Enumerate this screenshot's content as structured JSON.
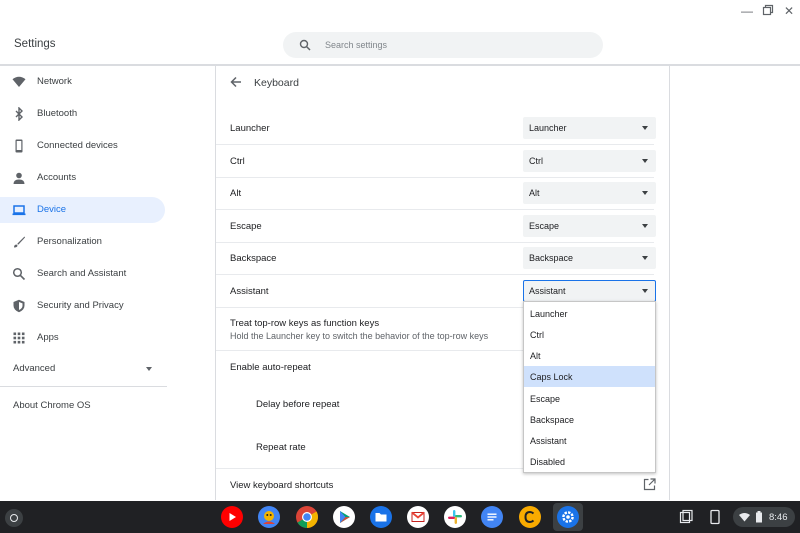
{
  "window": {
    "minimize_glyph": "—",
    "maximize_icon": "restore-icon",
    "close_glyph": "✕"
  },
  "app_title": "Settings",
  "search": {
    "placeholder": "Search settings",
    "icon": "search-icon"
  },
  "sidebar": {
    "items": [
      {
        "label": "Network",
        "icon": "wifi-icon",
        "active": false
      },
      {
        "label": "Bluetooth",
        "icon": "bluetooth-icon",
        "active": false
      },
      {
        "label": "Connected devices",
        "icon": "phone-icon",
        "active": false
      },
      {
        "label": "Accounts",
        "icon": "person-icon",
        "active": false
      },
      {
        "label": "Device",
        "icon": "laptop-icon",
        "active": true
      },
      {
        "label": "Personalization",
        "icon": "brush-icon",
        "active": false
      },
      {
        "label": "Search and Assistant",
        "icon": "search-icon",
        "active": false
      },
      {
        "label": "Security and Privacy",
        "icon": "shield-icon",
        "active": false
      },
      {
        "label": "Apps",
        "icon": "apps-grid-icon",
        "active": false
      }
    ],
    "advanced_label": "Advanced",
    "about_label": "About Chrome OS"
  },
  "main": {
    "title": "Keyboard",
    "rows": [
      {
        "label": "Launcher",
        "value": "Launcher"
      },
      {
        "label": "Ctrl",
        "value": "Ctrl"
      },
      {
        "label": "Alt",
        "value": "Alt"
      },
      {
        "label": "Escape",
        "value": "Escape"
      },
      {
        "label": "Backspace",
        "value": "Backspace"
      },
      {
        "label": "Assistant",
        "value": "Assistant"
      }
    ],
    "function_keys": {
      "label": "Treat top-row keys as function keys",
      "sublabel": "Hold the Launcher key to switch the behavior of the top-row keys"
    },
    "auto_repeat_label": "Enable auto-repeat",
    "delay_label": "Delay before repeat",
    "rate_label": "Repeat rate",
    "shortcuts_label": "View keyboard shortcuts"
  },
  "dropdown": {
    "options": [
      "Launcher",
      "Ctrl",
      "Alt",
      "Caps Lock",
      "Escape",
      "Backspace",
      "Assistant",
      "Disabled"
    ],
    "highlighted": "Caps Lock"
  },
  "shelf": {
    "apps": [
      "youtube-icon",
      "photo-app-icon",
      "chrome-icon",
      "play-store-icon",
      "files-icon",
      "gmail-icon",
      "slack-icon",
      "docs-icon",
      "coin-app-icon",
      "settings-gear-icon"
    ],
    "time": "8:46",
    "accent": "#1a73e8"
  }
}
